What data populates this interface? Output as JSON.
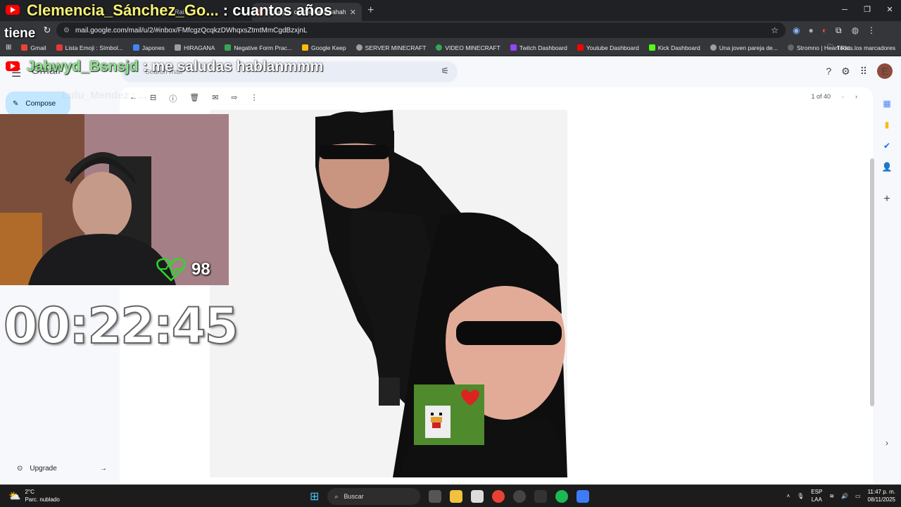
{
  "browser": {
    "tabs": [
      {
        "title": "Rai...",
        "active": false
      },
      {
        "title": "Tu y yo - contactoelabrahaham",
        "active": true
      }
    ],
    "url": "mail.google.com/mail/u/2/#inbox/FMfcgzQcqkzDWhqxsZtmtMmCgdBzxjnL",
    "bookmarks": [
      {
        "label": "Gmail",
        "color": "#ea4335"
      },
      {
        "label": "Lista Emoji : Símbol...",
        "color": "#e53935"
      },
      {
        "label": "Japones",
        "color": "#4285f4"
      },
      {
        "label": "HIRAGANA",
        "color": "#9e9e9e"
      },
      {
        "label": "Negative Form Prac...",
        "color": "#34a853"
      },
      {
        "label": "Google Keep",
        "color": "#fbbc04"
      },
      {
        "label": "SERVER MINECRAFT",
        "color": "#9e9e9e"
      },
      {
        "label": "VIDEO MINECRAFT",
        "color": "#34a853"
      },
      {
        "label": "Twitch Dashboard",
        "color": "#9146ff"
      },
      {
        "label": "Youtube Dashboard",
        "color": "#ff0000"
      },
      {
        "label": "Kick Dashboard",
        "color": "#53fc18"
      },
      {
        "label": "Una joven pareja de...",
        "color": "#9e9e9e"
      },
      {
        "label": "Stromno | Heart Rat...",
        "color": "#666666"
      }
    ],
    "all_bookmarks": "Todos los marcadores"
  },
  "gmail": {
    "logo": "Gmail",
    "search_placeholder": "Search mail",
    "compose": "Compose",
    "upgrade": "Upgrade",
    "pager": "1 of 40",
    "avatar": "E"
  },
  "overlay": {
    "chat_top_name": "Clemencia_Sánchez_Go...",
    "chat_top_msg": ": cuantos años",
    "chat_top_cont": "tiene",
    "chat2_name": "Jahwyd_Bsnsjd",
    "chat2_msg": ": me saludas hablanmmm",
    "chat3": "Lulu_Mendez : ...",
    "bpm": "98",
    "timer": "00:22:45"
  },
  "taskbar": {
    "temp": "2°C",
    "weather": "Parc. nublado",
    "search": "Buscar",
    "lang1": "ESP",
    "lang2": "LAA",
    "time": "11:47 p. m.",
    "date": "08/11/2025"
  }
}
